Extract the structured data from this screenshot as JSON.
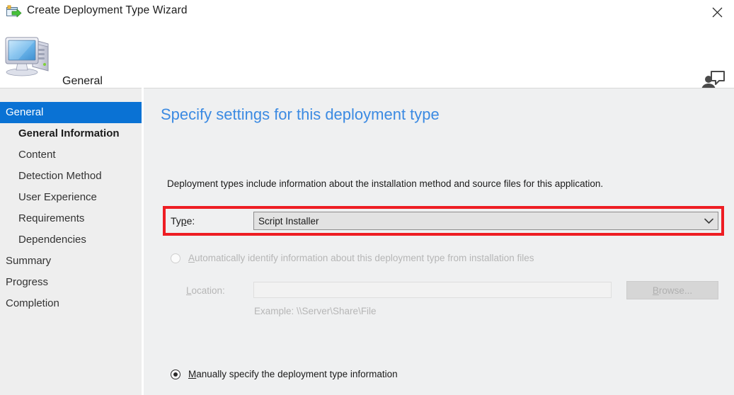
{
  "window": {
    "title": "Create Deployment Type Wizard",
    "icon": "deployment-type-wizard-icon",
    "close_label": "close-icon"
  },
  "header": {
    "title": "General",
    "icon": "computer-icon",
    "help_icon": "help-person-icon"
  },
  "sidebar": {
    "items": [
      {
        "label": "General",
        "level": 1,
        "selected": true,
        "current": false
      },
      {
        "label": "General Information",
        "level": 2,
        "selected": false,
        "current": true
      },
      {
        "label": "Content",
        "level": 2,
        "selected": false,
        "current": false
      },
      {
        "label": "Detection Method",
        "level": 2,
        "selected": false,
        "current": false
      },
      {
        "label": "User Experience",
        "level": 2,
        "selected": false,
        "current": false
      },
      {
        "label": "Requirements",
        "level": 2,
        "selected": false,
        "current": false
      },
      {
        "label": "Dependencies",
        "level": 2,
        "selected": false,
        "current": false
      },
      {
        "label": "Summary",
        "level": 1,
        "selected": false,
        "current": false
      },
      {
        "label": "Progress",
        "level": 1,
        "selected": false,
        "current": false
      },
      {
        "label": "Completion",
        "level": 1,
        "selected": false,
        "current": false
      }
    ]
  },
  "content": {
    "heading": "Specify settings for this deployment type",
    "description": "Deployment types include information about the installation method and source files for this application.",
    "type_field": {
      "label_prefix": "Ty",
      "label_accel": "p",
      "label_suffix": "e:",
      "value": "Script Installer",
      "arrow_icon": "chevron-down-icon"
    },
    "auto_radio": {
      "accel": "A",
      "text": "utomatically identify information about this deployment type from installation files",
      "checked": false,
      "disabled": true
    },
    "location_field": {
      "accel": "L",
      "label_rest": "ocation:",
      "value": "",
      "disabled": true
    },
    "browse_button": {
      "accel": "B",
      "label_rest": "rowse...",
      "disabled": true
    },
    "example_text": "Example: \\\\Server\\Share\\File",
    "manual_radio": {
      "accel": "M",
      "text": "anually specify the deployment type information",
      "checked": true,
      "disabled": false
    }
  },
  "annotation": {
    "highlight_color": "#ee1d23",
    "target": "type-dropdown-row"
  }
}
